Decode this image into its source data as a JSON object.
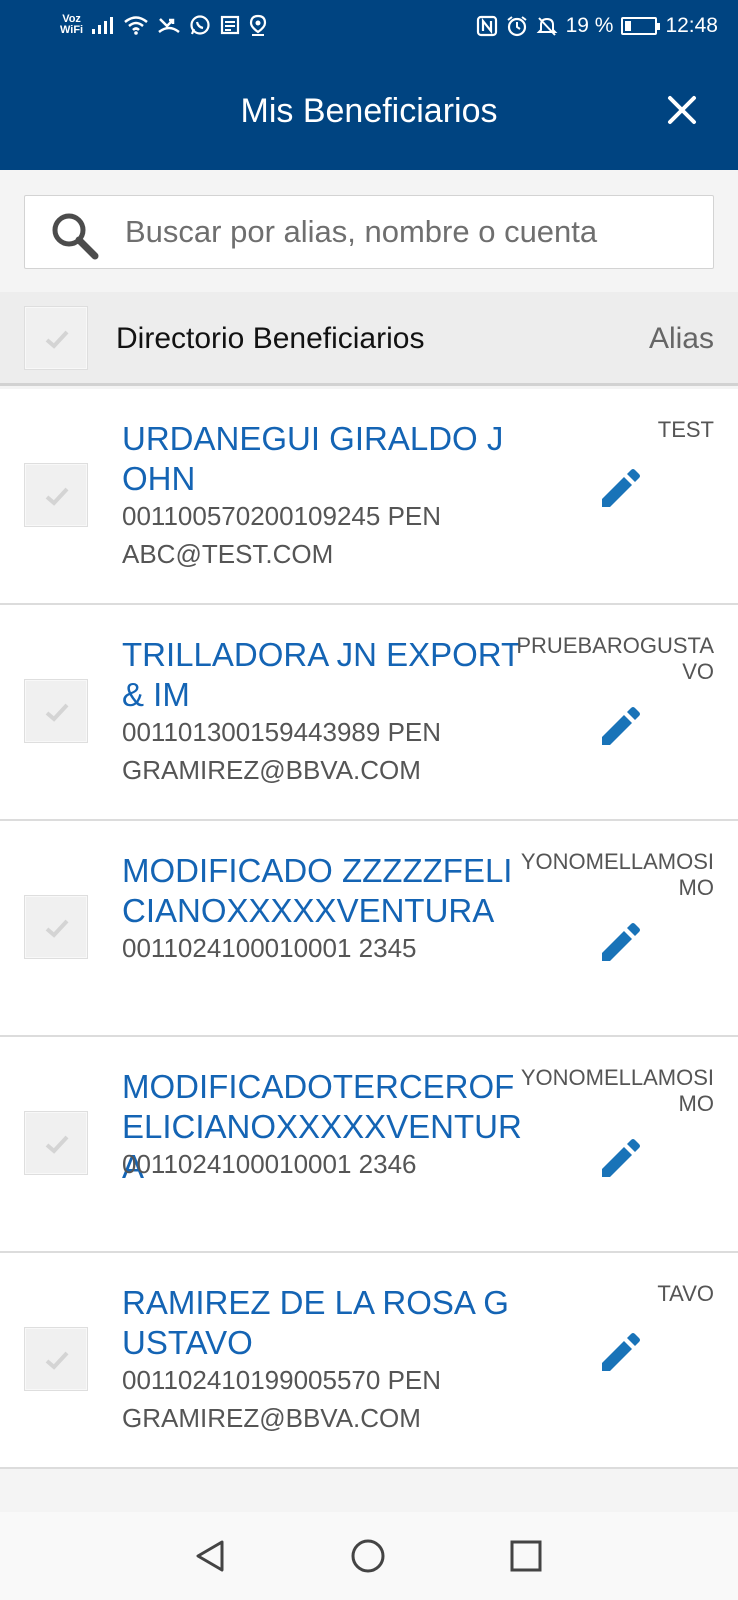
{
  "status_bar": {
    "voz": "Voz",
    "wifi": "WiFi",
    "battery": "19 %",
    "time": "12:48"
  },
  "header": {
    "title": "Mis Beneficiarios"
  },
  "search": {
    "placeholder": "Buscar por alias, nombre o cuenta",
    "value": ""
  },
  "directory": {
    "title": "Directorio Beneficiarios",
    "alias_label": "Alias"
  },
  "beneficiaries": [
    {
      "name": "URDANEGUI GIRALDO JOHN",
      "account": "001100570200109245 PEN",
      "email": "ABC@TEST.COM",
      "alias": "TEST"
    },
    {
      "name": "TRILLADORA JN EXPORT& IM",
      "account": "001101300159443989 PEN",
      "email": "GRAMIREZ@BBVA.COM",
      "alias": "PRUEBAROGUSTAVO"
    },
    {
      "name": "MODIFICADO ZZZZZFELICIANOXXXXXVENTURA",
      "account": "0011024100010001 2345",
      "email": "",
      "alias": "YONOMELLAMOSIMO"
    },
    {
      "name": "MODIFICADOTERCEROFELICIANOXXXXXVENTURA",
      "account": "0011024100010001 2346",
      "email": "",
      "alias": "YONOMELLAMOSIMO"
    },
    {
      "name": "RAMIREZ DE LA ROSA GUSTAVO",
      "account": "001102410199005570 PEN",
      "email": "GRAMIREZ@BBVA.COM",
      "alias": "TAVO"
    }
  ],
  "colors": {
    "brand_blue": "#004481",
    "link_blue": "#1464b4",
    "edit_blue": "#1973b8"
  }
}
